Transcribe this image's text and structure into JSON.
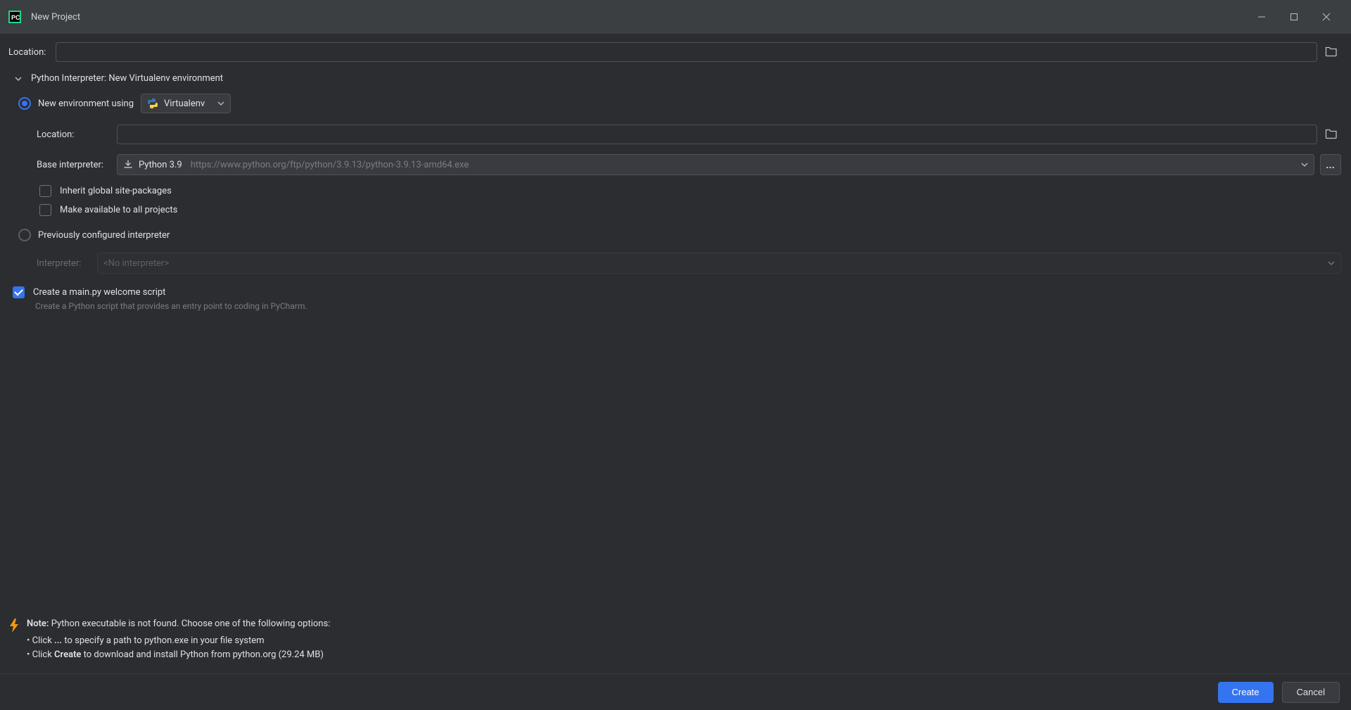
{
  "window": {
    "title": "New Project"
  },
  "location": {
    "label": "Location:",
    "value": ""
  },
  "interpreter_section": {
    "title": "Python Interpreter: New Virtualenv environment"
  },
  "env": {
    "new_env_label": "New environment using",
    "env_type": "Virtualenv",
    "venv_location_label": "Location:",
    "venv_location_value": "",
    "base_interpreter_label": "Base interpreter:",
    "base_python_version": "Python 3.9",
    "base_python_url": "https://www.python.org/ftp/python/3.9.13/python-3.9.13-amd64.exe",
    "inherit_label": "Inherit global site-packages",
    "make_available_label": "Make available to all projects",
    "prev_config_label": "Previously configured interpreter",
    "interpreter_label": "Interpreter:",
    "interpreter_value": "<No interpreter>"
  },
  "welcome": {
    "label": "Create a main.py welcome script",
    "hint": "Create a Python script that provides an entry point to coding in PyCharm."
  },
  "note": {
    "heading": "Note:",
    "body": " Python executable is not found. Choose one of the following options:",
    "bullet1_pre": "Click ",
    "bullet1_bold": "...",
    "bullet1_post": " to specify a path to python.exe in your file system",
    "bullet2_pre": "Click ",
    "bullet2_bold": "Create",
    "bullet2_post": " to download and install Python from python.org (29.24 MB)"
  },
  "buttons": {
    "create": "Create",
    "cancel": "Cancel"
  }
}
